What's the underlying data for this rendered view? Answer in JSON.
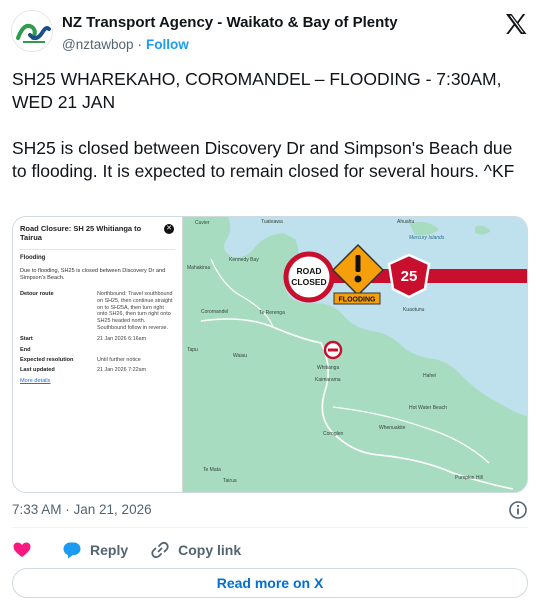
{
  "author": {
    "name": "NZ Transport Agency - Waikato & Bay of Plenty",
    "handle": "@nztawbop",
    "separator": "·",
    "follow_label": "Follow"
  },
  "tweet": {
    "headline": "SH25 WHAREKAHO, COROMANDEL – FLOODING - 7:30AM, WED 21 JAN",
    "body": "SH25 is closed between Discovery Dr and Simpson's Beach due to flooding. It is expected to remain closed for several hours. ^KF",
    "timestamp": "7:33 AM · Jan 21, 2026"
  },
  "media": {
    "panel": {
      "title": "Road Closure: SH 25 Whitianga to Tairua",
      "heading": "Flooding",
      "description": "Due to flooding, SH25 is closed between Discovery Dr and Simpson's Beach.",
      "rows": [
        {
          "key": "Detour route",
          "value": "Northbound: Travel southbound on SH25, then continue straight on to SH25A, then turn right onto SH26, then turn right onto SH25 headed north. Southbound follow in reverse."
        },
        {
          "key": "Start",
          "value": "21 Jan 2026 6:16am"
        },
        {
          "key": "End",
          "value": ""
        },
        {
          "key": "Expected resolution",
          "value": "Until further notice"
        },
        {
          "key": "Last updated",
          "value": "21 Jan 2026 7:22am"
        }
      ],
      "more_link": "More details",
      "close_glyph": "✕"
    },
    "map": {
      "road_closed_sign": [
        "ROAD",
        "CLOSED"
      ],
      "flooding_sign": "FLOODING",
      "route_shield": "25",
      "place_labels": [
        "Cuvier",
        "Tuateawa",
        "Kennedy Bay",
        "Mahakirau",
        "Coromandel",
        "Te Rerenga",
        "Kuaotunu",
        "Whitianga",
        "Kaimarama",
        "Tapu",
        "Whenuakite",
        "Hot Water Beach",
        "Hahei",
        "Pumpkin Hill",
        "Te Mata",
        "Coroglen",
        "Waiau",
        "Tairua",
        "Mercury Islands",
        "Ahuahu"
      ]
    },
    "colors": {
      "water": "#bfe1ee",
      "land": "#a8dcc0",
      "closure_red": "#c8102e",
      "warning_orange": "#f5a00a"
    }
  },
  "actions": {
    "like_label": "",
    "reply_label": "Reply",
    "copy_label": "Copy link"
  },
  "read_more_label": "Read more on X"
}
